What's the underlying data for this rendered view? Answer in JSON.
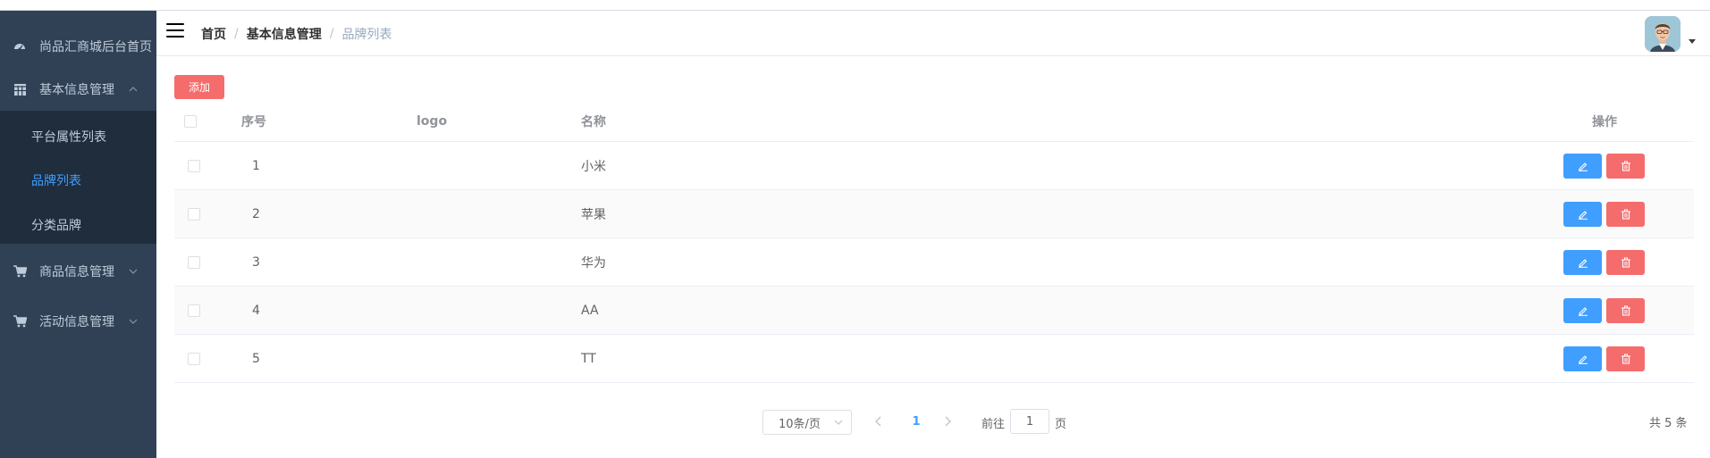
{
  "sidebar": {
    "home_label": "尚品汇商城后台首页",
    "groups": [
      {
        "label": "基本信息管理",
        "icon": "grid-icon",
        "expanded": true,
        "items": [
          {
            "label": "平台属性列表",
            "active": false
          },
          {
            "label": "品牌列表",
            "active": true
          },
          {
            "label": "分类品牌",
            "active": false
          }
        ]
      },
      {
        "label": "商品信息管理",
        "icon": "cart-icon",
        "expanded": false
      },
      {
        "label": "活动信息管理",
        "icon": "cart-icon",
        "expanded": false
      }
    ]
  },
  "header": {
    "breadcrumb": [
      "首页",
      "基本信息管理",
      "品牌列表"
    ],
    "separator": "/"
  },
  "toolbar": {
    "add_label": "添加"
  },
  "table": {
    "headers": {
      "index": "序号",
      "logo": "logo",
      "name": "名称",
      "actions": "操作"
    },
    "rows": [
      {
        "index": "1",
        "name": "小米"
      },
      {
        "index": "2",
        "name": "苹果"
      },
      {
        "index": "3",
        "name": "华为"
      },
      {
        "index": "4",
        "name": "AA"
      },
      {
        "index": "5",
        "name": "TT"
      }
    ]
  },
  "pagination": {
    "page_size": "10条/页",
    "current_page": "1",
    "goto_prefix": "前往",
    "goto_value": "1",
    "goto_suffix": "页",
    "total": "共 5 条"
  },
  "colors": {
    "primary": "#409eff",
    "danger": "#f56c6c",
    "sidebar_bg": "#304156",
    "submenu_bg": "#1f2d3d"
  }
}
